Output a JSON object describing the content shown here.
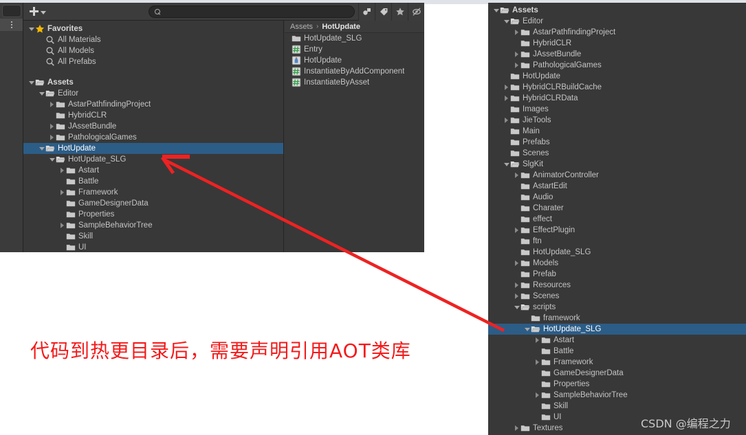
{
  "left_panel": {
    "toolbar": {
      "add_label": "+",
      "search_value": "",
      "search_placeholder": "",
      "icons": [
        "asset-filter-icon",
        "label-filter-icon",
        "favorite-filter-icon",
        "hidden-filter-icon"
      ]
    },
    "tree": [
      {
        "label": "Favorites",
        "depth": 0,
        "twisty": "down",
        "icon": "star-icon",
        "bold": true,
        "selected": false
      },
      {
        "label": "All Materials",
        "depth": 1,
        "twisty": "none",
        "icon": "search-icon",
        "bold": false,
        "selected": false
      },
      {
        "label": "All Models",
        "depth": 1,
        "twisty": "none",
        "icon": "search-icon",
        "bold": false,
        "selected": false
      },
      {
        "label": "All Prefabs",
        "depth": 1,
        "twisty": "none",
        "icon": "search-icon",
        "bold": false,
        "selected": false
      },
      {
        "label": "",
        "depth": 0,
        "twisty": "none",
        "icon": "none",
        "bold": false,
        "selected": false
      },
      {
        "label": "Assets",
        "depth": 0,
        "twisty": "down",
        "icon": "folder-open-icon",
        "bold": true,
        "selected": false
      },
      {
        "label": "Editor",
        "depth": 1,
        "twisty": "down",
        "icon": "folder-open-icon",
        "bold": false,
        "selected": false
      },
      {
        "label": "AstarPathfindingProject",
        "depth": 2,
        "twisty": "right",
        "icon": "folder-icon",
        "bold": false,
        "selected": false
      },
      {
        "label": "HybridCLR",
        "depth": 2,
        "twisty": "none",
        "icon": "folder-icon",
        "bold": false,
        "selected": false
      },
      {
        "label": "JAssetBundle",
        "depth": 2,
        "twisty": "right",
        "icon": "folder-icon",
        "bold": false,
        "selected": false
      },
      {
        "label": "PathologicalGames",
        "depth": 2,
        "twisty": "right",
        "icon": "folder-icon",
        "bold": false,
        "selected": false
      },
      {
        "label": "HotUpdate",
        "depth": 1,
        "twisty": "down",
        "icon": "folder-open-icon",
        "bold": false,
        "selected": true
      },
      {
        "label": "HotUpdate_SLG",
        "depth": 2,
        "twisty": "down",
        "icon": "folder-open-icon",
        "bold": false,
        "selected": false
      },
      {
        "label": "Astart",
        "depth": 3,
        "twisty": "right",
        "icon": "folder-icon",
        "bold": false,
        "selected": false
      },
      {
        "label": "Battle",
        "depth": 3,
        "twisty": "none",
        "icon": "folder-icon",
        "bold": false,
        "selected": false
      },
      {
        "label": "Framework",
        "depth": 3,
        "twisty": "right",
        "icon": "folder-icon",
        "bold": false,
        "selected": false
      },
      {
        "label": "GameDesignerData",
        "depth": 3,
        "twisty": "none",
        "icon": "folder-icon",
        "bold": false,
        "selected": false
      },
      {
        "label": "Properties",
        "depth": 3,
        "twisty": "none",
        "icon": "folder-icon",
        "bold": false,
        "selected": false
      },
      {
        "label": "SampleBehaviorTree",
        "depth": 3,
        "twisty": "right",
        "icon": "folder-icon",
        "bold": false,
        "selected": false
      },
      {
        "label": "Skill",
        "depth": 3,
        "twisty": "none",
        "icon": "folder-icon",
        "bold": false,
        "selected": false
      },
      {
        "label": "UI",
        "depth": 3,
        "twisty": "none",
        "icon": "folder-icon",
        "bold": false,
        "selected": false
      }
    ],
    "breadcrumb": {
      "root": "Assets",
      "separator": "›",
      "current": "HotUpdate"
    },
    "files": [
      {
        "label": "HotUpdate_SLG",
        "icon": "folder-icon"
      },
      {
        "label": "Entry",
        "icon": "csharp-script-icon"
      },
      {
        "label": "HotUpdate",
        "icon": "assembly-definition-icon"
      },
      {
        "label": "InstantiateByAddComponent",
        "icon": "csharp-script-icon"
      },
      {
        "label": "InstantiateByAsset",
        "icon": "csharp-script-icon"
      }
    ]
  },
  "right_panel": {
    "tree": [
      {
        "label": "Assets",
        "depth": 0,
        "twisty": "down",
        "icon": "folder-open-icon",
        "bold": true,
        "selected": false
      },
      {
        "label": "Editor",
        "depth": 1,
        "twisty": "down",
        "icon": "folder-open-icon",
        "bold": false,
        "selected": false
      },
      {
        "label": "AstarPathfindingProject",
        "depth": 2,
        "twisty": "right",
        "icon": "folder-icon",
        "bold": false,
        "selected": false
      },
      {
        "label": "HybridCLR",
        "depth": 2,
        "twisty": "none",
        "icon": "folder-icon",
        "bold": false,
        "selected": false
      },
      {
        "label": "JAssetBundle",
        "depth": 2,
        "twisty": "right",
        "icon": "folder-icon",
        "bold": false,
        "selected": false
      },
      {
        "label": "PathologicalGames",
        "depth": 2,
        "twisty": "right",
        "icon": "folder-icon",
        "bold": false,
        "selected": false
      },
      {
        "label": "HotUpdate",
        "depth": 1,
        "twisty": "none",
        "icon": "folder-icon",
        "bold": false,
        "selected": false
      },
      {
        "label": "HybridCLRBuildCache",
        "depth": 1,
        "twisty": "right",
        "icon": "folder-icon",
        "bold": false,
        "selected": false
      },
      {
        "label": "HybridCLRData",
        "depth": 1,
        "twisty": "right",
        "icon": "folder-icon",
        "bold": false,
        "selected": false
      },
      {
        "label": "Images",
        "depth": 1,
        "twisty": "none",
        "icon": "folder-icon",
        "bold": false,
        "selected": false
      },
      {
        "label": "JieTools",
        "depth": 1,
        "twisty": "right",
        "icon": "folder-icon",
        "bold": false,
        "selected": false
      },
      {
        "label": "Main",
        "depth": 1,
        "twisty": "none",
        "icon": "folder-icon",
        "bold": false,
        "selected": false
      },
      {
        "label": "Prefabs",
        "depth": 1,
        "twisty": "none",
        "icon": "folder-icon",
        "bold": false,
        "selected": false
      },
      {
        "label": "Scenes",
        "depth": 1,
        "twisty": "none",
        "icon": "folder-icon",
        "bold": false,
        "selected": false
      },
      {
        "label": "SlgKit",
        "depth": 1,
        "twisty": "down",
        "icon": "folder-open-icon",
        "bold": false,
        "selected": false
      },
      {
        "label": "AnimatorController",
        "depth": 2,
        "twisty": "right",
        "icon": "folder-icon",
        "bold": false,
        "selected": false
      },
      {
        "label": "AstartEdit",
        "depth": 2,
        "twisty": "none",
        "icon": "folder-icon",
        "bold": false,
        "selected": false
      },
      {
        "label": "Audio",
        "depth": 2,
        "twisty": "none",
        "icon": "folder-icon",
        "bold": false,
        "selected": false
      },
      {
        "label": "Charater",
        "depth": 2,
        "twisty": "none",
        "icon": "folder-icon",
        "bold": false,
        "selected": false
      },
      {
        "label": "effect",
        "depth": 2,
        "twisty": "none",
        "icon": "folder-icon",
        "bold": false,
        "selected": false
      },
      {
        "label": "EffectPlugin",
        "depth": 2,
        "twisty": "right",
        "icon": "folder-icon",
        "bold": false,
        "selected": false
      },
      {
        "label": "ftn",
        "depth": 2,
        "twisty": "none",
        "icon": "folder-icon",
        "bold": false,
        "selected": false
      },
      {
        "label": "HotUpdate_SLG",
        "depth": 2,
        "twisty": "none",
        "icon": "folder-icon",
        "bold": false,
        "selected": false
      },
      {
        "label": "Models",
        "depth": 2,
        "twisty": "right",
        "icon": "folder-icon",
        "bold": false,
        "selected": false
      },
      {
        "label": "Prefab",
        "depth": 2,
        "twisty": "none",
        "icon": "folder-icon",
        "bold": false,
        "selected": false
      },
      {
        "label": "Resources",
        "depth": 2,
        "twisty": "right",
        "icon": "folder-icon",
        "bold": false,
        "selected": false
      },
      {
        "label": "Scenes",
        "depth": 2,
        "twisty": "right",
        "icon": "folder-icon",
        "bold": false,
        "selected": false
      },
      {
        "label": "scripts",
        "depth": 2,
        "twisty": "down",
        "icon": "folder-open-icon",
        "bold": false,
        "selected": false
      },
      {
        "label": "framework",
        "depth": 3,
        "twisty": "none",
        "icon": "folder-icon",
        "bold": false,
        "selected": false
      },
      {
        "label": "HotUpdate_SLG",
        "depth": 3,
        "twisty": "down",
        "icon": "folder-open-icon",
        "bold": false,
        "selected": true
      },
      {
        "label": "Astart",
        "depth": 4,
        "twisty": "right",
        "icon": "folder-icon",
        "bold": false,
        "selected": false
      },
      {
        "label": "Battle",
        "depth": 4,
        "twisty": "none",
        "icon": "folder-icon",
        "bold": false,
        "selected": false
      },
      {
        "label": "Framework",
        "depth": 4,
        "twisty": "right",
        "icon": "folder-icon",
        "bold": false,
        "selected": false
      },
      {
        "label": "GameDesignerData",
        "depth": 4,
        "twisty": "none",
        "icon": "folder-icon",
        "bold": false,
        "selected": false
      },
      {
        "label": "Properties",
        "depth": 4,
        "twisty": "none",
        "icon": "folder-icon",
        "bold": false,
        "selected": false
      },
      {
        "label": "SampleBehaviorTree",
        "depth": 4,
        "twisty": "right",
        "icon": "folder-icon",
        "bold": false,
        "selected": false
      },
      {
        "label": "Skill",
        "depth": 4,
        "twisty": "none",
        "icon": "folder-icon",
        "bold": false,
        "selected": false
      },
      {
        "label": "UI",
        "depth": 4,
        "twisty": "none",
        "icon": "folder-icon",
        "bold": false,
        "selected": false
      },
      {
        "label": "Textures",
        "depth": 2,
        "twisty": "right",
        "icon": "folder-icon",
        "bold": false,
        "selected": false
      }
    ]
  },
  "annotation": {
    "caption": "代码到热更目录后，需要声明引用AOT类库",
    "caption_color": "#f41b1b",
    "arrow_color": "#ee2222"
  },
  "watermark": {
    "text": "CSDN @编程之力"
  },
  "colors": {
    "panel_bg": "#383838",
    "toolbar_bg": "#3c3c3c",
    "selection_blue": "#2c5d87",
    "text": "#c4c4c4",
    "folder": "#c9c9c9",
    "star": "#f2b705",
    "script_green": "#4caf50",
    "asmdef_blue": "#5b9bd5"
  }
}
